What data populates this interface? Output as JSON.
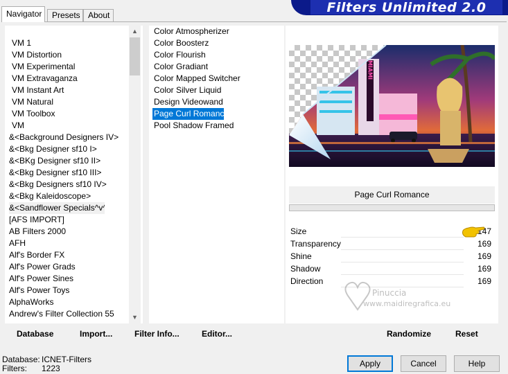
{
  "tabs": [
    {
      "label": "Navigator"
    },
    {
      "label": "Presets"
    },
    {
      "label": "About"
    }
  ],
  "banner": {
    "title": "Filters Unlimited 2.0"
  },
  "categories": [
    "VM 1",
    "VM Distortion",
    "VM Experimental",
    "VM Extravaganza",
    "VM Instant Art",
    "VM Natural",
    "VM Toolbox",
    "VM",
    "&<Background Designers IV>",
    "&<Bkg Designer sf10 I>",
    "&<BKg Designer sf10 II>",
    "&<Bkg Designer sf10 III>",
    "&<Bkg Designers sf10 IV>",
    "&<Bkg Kaleidoscope>",
    "&<Sandflower Specials^v^ >",
    "[AFS IMPORT]",
    "AB Filters 2000",
    "AFH",
    "Alf's Border FX",
    "Alf's Power Grads",
    "Alf's Power Sines",
    "Alf's Power Toys",
    "AlphaWorks",
    "Andrew's Filter Collection 55"
  ],
  "filters": [
    "Color Atmospherizer",
    "Color Boosterz",
    "Color Flourish",
    "Color Gradiant",
    "Color Mapped Switcher",
    "Color Silver Liquid",
    "Design Videowand",
    "Page Curl Romance",
    "Pool Shadow Framed"
  ],
  "preview": {
    "filter_name": "Page Curl Romance",
    "sign_text": "MIAMI"
  },
  "params": [
    {
      "label": "Size",
      "value": "147"
    },
    {
      "label": "Transparency",
      "value": "169"
    },
    {
      "label": "Shine",
      "value": "169"
    },
    {
      "label": "Shadow",
      "value": "169"
    },
    {
      "label": "Direction",
      "value": "169"
    }
  ],
  "watermark": {
    "name": "Pinuccia",
    "site": "www.maidiregrafica.eu"
  },
  "toolbar": {
    "database": "Database",
    "import": "Import...",
    "filter_info": "Filter Info...",
    "editor": "Editor...",
    "randomize": "Randomize",
    "reset": "Reset"
  },
  "status": {
    "database_label": "Database:",
    "database_value": "ICNET-Filters",
    "filters_label": "Filters:",
    "filters_value": "1223"
  },
  "buttons": {
    "apply": "Apply",
    "cancel": "Cancel",
    "help": "Help"
  },
  "colors": {
    "selection": "#0078d7",
    "banner": "#1d2fb0"
  }
}
